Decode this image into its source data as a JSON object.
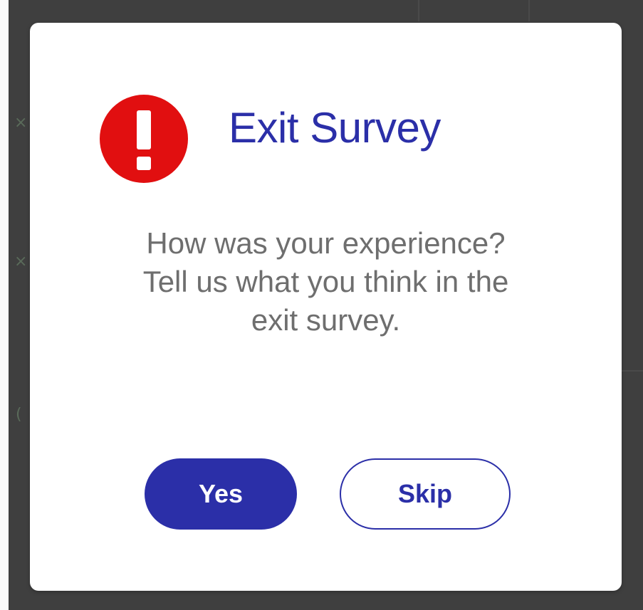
{
  "dialog": {
    "title": "Exit Survey",
    "icon": "alert-exclamation-icon",
    "message_lines": [
      "How was your experience?",
      "Tell us what you think in the",
      "exit survey."
    ],
    "buttons": {
      "yes_label": "Yes",
      "skip_label": "Skip"
    }
  },
  "colors": {
    "accent": "#2b2fa8",
    "alert": "#e10f10",
    "message_text": "#6e6e6e",
    "backdrop": "#3f3f3f"
  }
}
